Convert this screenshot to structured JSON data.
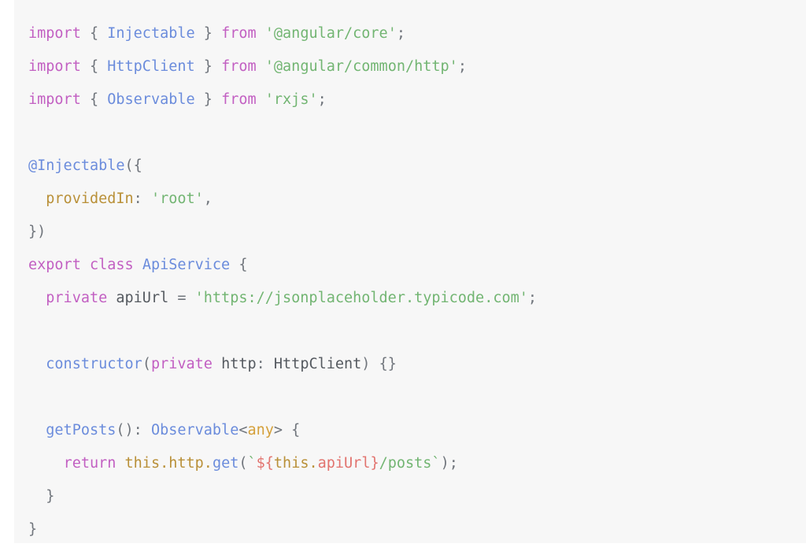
{
  "snippet": {
    "language": "typescript",
    "framework": "angular",
    "background_color": "#f7f7f7",
    "page_background": "#ffffff",
    "colors": {
      "keyword": "#c25fc2",
      "type": "#6b8cdc",
      "function": "#6b8cdc",
      "string": "#72b572",
      "property": "#b99038",
      "plain": "#555a60",
      "any_type": "#d5a03a",
      "interpolation": "#e2736e",
      "punctuation": "#70757c"
    },
    "lines": [
      {
        "id": "line-1",
        "tokens": [
          {
            "text": "import",
            "kind": "kw"
          },
          {
            "text": " ",
            "kind": "plain"
          },
          {
            "text": "{",
            "kind": "punc"
          },
          {
            "text": " ",
            "kind": "plain"
          },
          {
            "text": "Injectable",
            "kind": "type"
          },
          {
            "text": " ",
            "kind": "plain"
          },
          {
            "text": "}",
            "kind": "punc"
          },
          {
            "text": " ",
            "kind": "plain"
          },
          {
            "text": "from",
            "kind": "kw"
          },
          {
            "text": " ",
            "kind": "plain"
          },
          {
            "text": "'@angular/core'",
            "kind": "str"
          },
          {
            "text": ";",
            "kind": "punc"
          }
        ]
      },
      {
        "id": "line-2",
        "tokens": [
          {
            "text": "import",
            "kind": "kw"
          },
          {
            "text": " ",
            "kind": "plain"
          },
          {
            "text": "{",
            "kind": "punc"
          },
          {
            "text": " ",
            "kind": "plain"
          },
          {
            "text": "HttpClient",
            "kind": "type"
          },
          {
            "text": " ",
            "kind": "plain"
          },
          {
            "text": "}",
            "kind": "punc"
          },
          {
            "text": " ",
            "kind": "plain"
          },
          {
            "text": "from",
            "kind": "kw"
          },
          {
            "text": " ",
            "kind": "plain"
          },
          {
            "text": "'@angular/common/http'",
            "kind": "str"
          },
          {
            "text": ";",
            "kind": "punc"
          }
        ]
      },
      {
        "id": "line-3",
        "tokens": [
          {
            "text": "import",
            "kind": "kw"
          },
          {
            "text": " ",
            "kind": "plain"
          },
          {
            "text": "{",
            "kind": "punc"
          },
          {
            "text": " ",
            "kind": "plain"
          },
          {
            "text": "Observable",
            "kind": "type"
          },
          {
            "text": " ",
            "kind": "plain"
          },
          {
            "text": "}",
            "kind": "punc"
          },
          {
            "text": " ",
            "kind": "plain"
          },
          {
            "text": "from",
            "kind": "kw"
          },
          {
            "text": " ",
            "kind": "plain"
          },
          {
            "text": "'rxjs'",
            "kind": "str"
          },
          {
            "text": ";",
            "kind": "punc"
          }
        ]
      },
      {
        "id": "line-4",
        "tokens": []
      },
      {
        "id": "line-5",
        "tokens": [
          {
            "text": "@Injectable",
            "kind": "type"
          },
          {
            "text": "({",
            "kind": "punc"
          }
        ]
      },
      {
        "id": "line-6",
        "tokens": [
          {
            "text": "  ",
            "kind": "plain"
          },
          {
            "text": "providedIn",
            "kind": "prop"
          },
          {
            "text": ": ",
            "kind": "punc"
          },
          {
            "text": "'root'",
            "kind": "str"
          },
          {
            "text": ",",
            "kind": "punc"
          }
        ]
      },
      {
        "id": "line-7",
        "tokens": [
          {
            "text": "})",
            "kind": "punc"
          }
        ]
      },
      {
        "id": "line-8",
        "tokens": [
          {
            "text": "export",
            "kind": "kw"
          },
          {
            "text": " ",
            "kind": "plain"
          },
          {
            "text": "class",
            "kind": "kw"
          },
          {
            "text": " ",
            "kind": "plain"
          },
          {
            "text": "ApiService",
            "kind": "type"
          },
          {
            "text": " ",
            "kind": "plain"
          },
          {
            "text": "{",
            "kind": "punc"
          }
        ]
      },
      {
        "id": "line-9",
        "tokens": [
          {
            "text": "  ",
            "kind": "plain"
          },
          {
            "text": "private",
            "kind": "kw"
          },
          {
            "text": " ",
            "kind": "plain"
          },
          {
            "text": "apiUrl",
            "kind": "plain"
          },
          {
            "text": " ",
            "kind": "plain"
          },
          {
            "text": "=",
            "kind": "punc"
          },
          {
            "text": " ",
            "kind": "plain"
          },
          {
            "text": "'https://jsonplaceholder.typicode.com'",
            "kind": "str"
          },
          {
            "text": ";",
            "kind": "punc"
          }
        ]
      },
      {
        "id": "line-10",
        "tokens": []
      },
      {
        "id": "line-11",
        "tokens": [
          {
            "text": "  ",
            "kind": "plain"
          },
          {
            "text": "constructor",
            "kind": "fn"
          },
          {
            "text": "(",
            "kind": "punc"
          },
          {
            "text": "private",
            "kind": "kw"
          },
          {
            "text": " ",
            "kind": "plain"
          },
          {
            "text": "http",
            "kind": "plain"
          },
          {
            "text": ": ",
            "kind": "punc"
          },
          {
            "text": "HttpClient",
            "kind": "plain"
          },
          {
            "text": ") {}",
            "kind": "punc"
          }
        ]
      },
      {
        "id": "line-12",
        "tokens": []
      },
      {
        "id": "line-13",
        "tokens": [
          {
            "text": "  ",
            "kind": "plain"
          },
          {
            "text": "getPosts",
            "kind": "fn"
          },
          {
            "text": "(): ",
            "kind": "punc"
          },
          {
            "text": "Observable",
            "kind": "type"
          },
          {
            "text": "<",
            "kind": "punc"
          },
          {
            "text": "any",
            "kind": "any"
          },
          {
            "text": "> {",
            "kind": "punc"
          }
        ]
      },
      {
        "id": "line-14",
        "tokens": [
          {
            "text": "    ",
            "kind": "plain"
          },
          {
            "text": "return",
            "kind": "kw"
          },
          {
            "text": " ",
            "kind": "plain"
          },
          {
            "text": "this",
            "kind": "prop"
          },
          {
            "text": ".",
            "kind": "prop"
          },
          {
            "text": "http",
            "kind": "prop"
          },
          {
            "text": ".",
            "kind": "prop"
          },
          {
            "text": "get",
            "kind": "fn"
          },
          {
            "text": "(",
            "kind": "punc"
          },
          {
            "text": "`",
            "kind": "str"
          },
          {
            "text": "${",
            "kind": "interp"
          },
          {
            "text": "this",
            "kind": "prop"
          },
          {
            "text": ".",
            "kind": "prop"
          },
          {
            "text": "apiUrl",
            "kind": "interp"
          },
          {
            "text": "}",
            "kind": "interp"
          },
          {
            "text": "/posts",
            "kind": "str"
          },
          {
            "text": "`",
            "kind": "str"
          },
          {
            "text": ");",
            "kind": "punc"
          }
        ]
      },
      {
        "id": "line-15",
        "tokens": [
          {
            "text": "  ",
            "kind": "plain"
          },
          {
            "text": "}",
            "kind": "punc"
          }
        ]
      },
      {
        "id": "line-16",
        "tokens": [
          {
            "text": "}",
            "kind": "punc"
          }
        ]
      }
    ]
  }
}
